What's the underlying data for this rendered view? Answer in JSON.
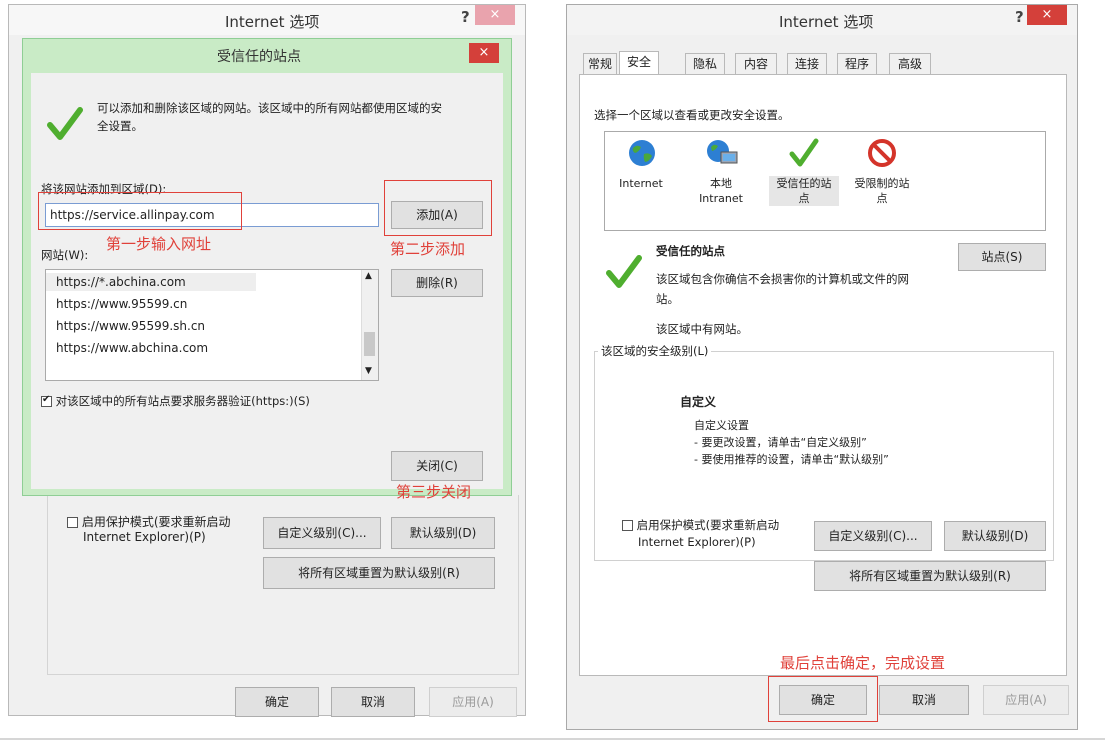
{
  "left_window": {
    "title": "Internet 选项",
    "help": "?",
    "close": "×",
    "behind": {
      "protected_mode_line1": "启用保护模式(要求重新启动",
      "protected_mode_line2": "Internet Explorer)(P)",
      "custom_level": "自定义级别(C)...",
      "default_level": "默认级别(D)",
      "reset_all": "将所有区域重置为默认级别(R)",
      "ok": "确定",
      "cancel": "取消",
      "apply": "应用(A)"
    }
  },
  "trusted_dialog": {
    "title": "受信任的站点",
    "close": "×",
    "description_line1": "可以添加和删除该区域的网站。该区域中的所有网站都使用区域的安",
    "description_line2": "全设置。",
    "add_label": "将该网站添加到区域(D):",
    "add_input_value": "https://service.allinpay.com",
    "add_button": "添加(A)",
    "websites_label": "网站(W):",
    "websites": [
      "https://*.abchina.com",
      "https://www.95599.cn",
      "https://www.95599.sh.cn",
      "https://www.abchina.com"
    ],
    "remove_button": "删除(R)",
    "https_checkbox": "对该区域中的所有站点要求服务器验证(https:)(S)",
    "close_button": "关闭(C)"
  },
  "annotations": {
    "step1": "第一步输入网址",
    "step2": "第二步添加",
    "step3": "第三步关闭",
    "final": "最后点击确定，完成设置"
  },
  "right_window": {
    "title": "Internet 选项",
    "help": "?",
    "close": "×",
    "tabs": [
      "常规",
      "安全",
      "隐私",
      "内容",
      "连接",
      "程序",
      "高级"
    ],
    "active_tab": "安全",
    "select_zone_text": "选择一个区域以查看或更改安全设置。",
    "zones": [
      {
        "line1": "Internet",
        "line2": "",
        "icon": "globe-icon"
      },
      {
        "line1": "本地",
        "line2": "Intranet",
        "icon": "intranet-icon"
      },
      {
        "line1": "受信任的站",
        "line2": "点",
        "icon": "check-icon"
      },
      {
        "line1": "受限制的站",
        "line2": "点",
        "icon": "restricted-icon"
      }
    ],
    "zone_title": "受信任的站点",
    "zone_desc_line1": "该区域包含你确信不会损害你的计算机或文件的网",
    "zone_desc_line2": "站。",
    "zone_has_sites": "该区域中有网站。",
    "sites_button": "站点(S)",
    "security_level_label": "该区域的安全级别(L)",
    "custom_title": "自定义",
    "custom_line1": "自定义设置",
    "custom_line2": "- 要更改设置，请单击“自定义级别”",
    "custom_line3": "- 要使用推荐的设置，请单击“默认级别”",
    "protected_mode_line1": "启用保护模式(要求重新启动",
    "protected_mode_line2": "Internet Explorer)(P)",
    "custom_level": "自定义级别(C)...",
    "default_level": "默认级别(D)",
    "reset_all": "将所有区域重置为默认级别(R)",
    "ok": "确定",
    "cancel": "取消",
    "apply": "应用(A)"
  },
  "colors": {
    "annotation_red": "#e0413a",
    "dialog_green_border": "#8fce95",
    "close_red": "#d4403a",
    "close_pink": "#e9a3ad",
    "check_green": "#4fae2f"
  }
}
